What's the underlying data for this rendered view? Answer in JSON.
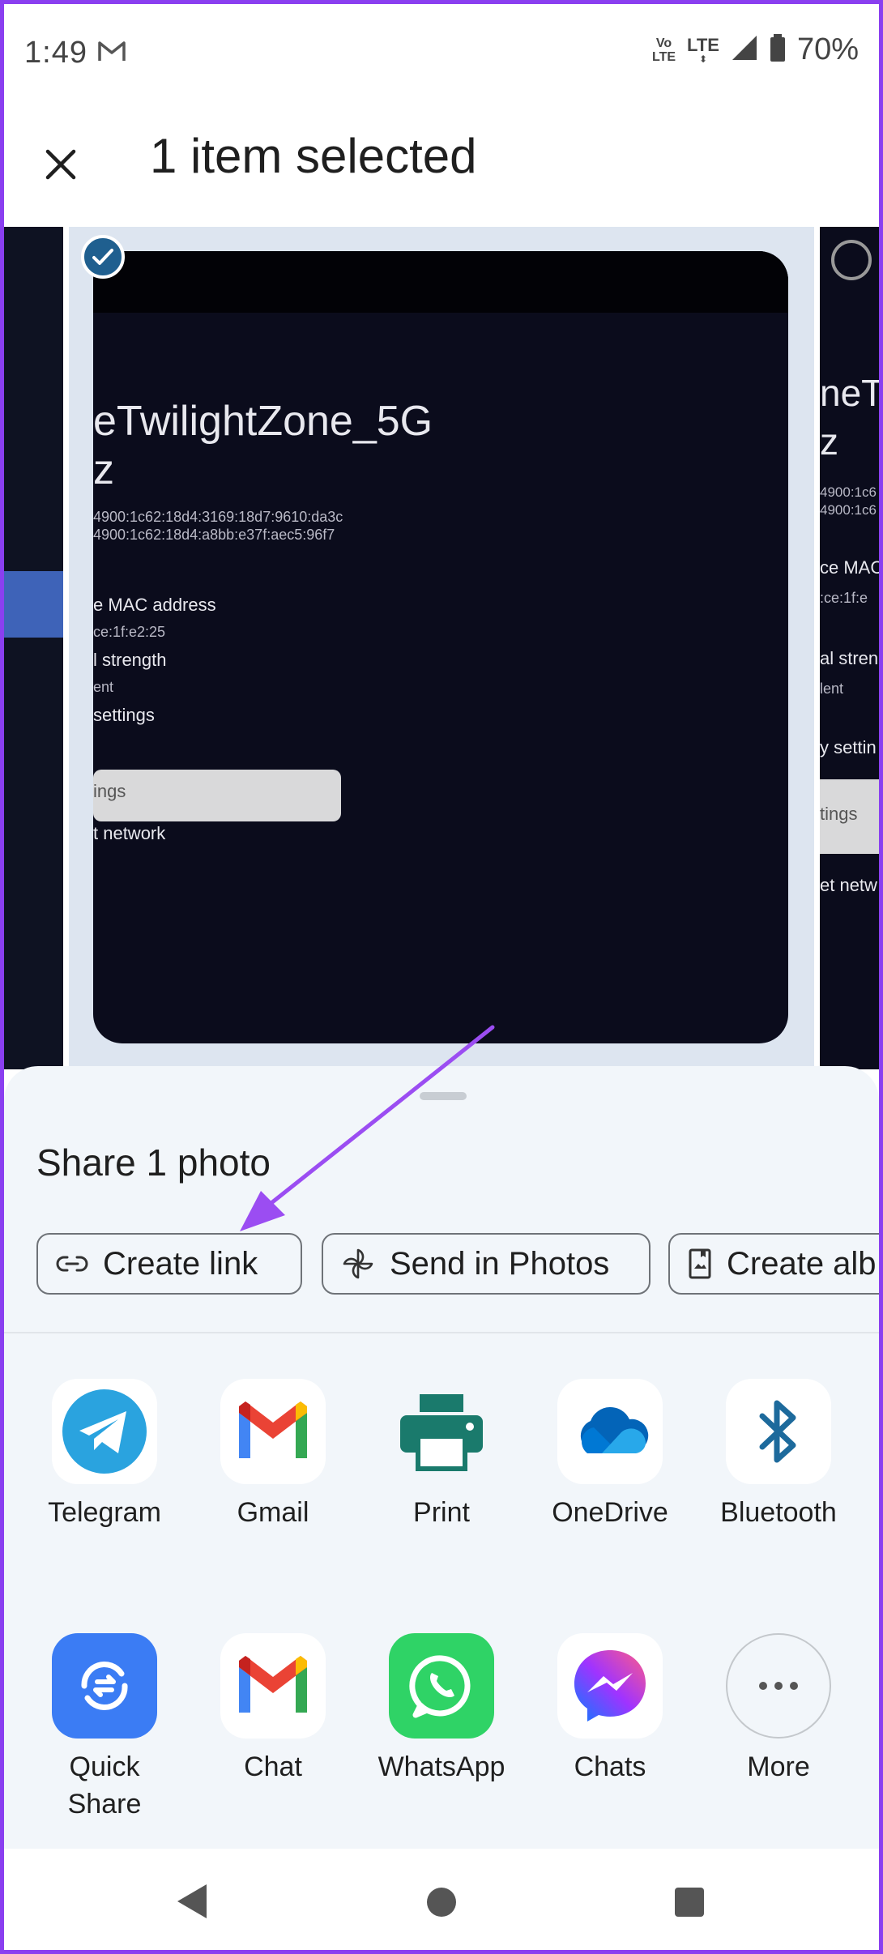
{
  "status_bar": {
    "time": "1:49",
    "network_volte_top": "Vo",
    "network_volte_bottom": "LTE",
    "network_lte": "LTE",
    "battery_percent": "70%"
  },
  "header": {
    "title": "1 item selected"
  },
  "photo": {
    "network_name": "eTwilightZone_5G",
    "partial_line": "z",
    "ipv6_line1": "4900:1c62:18d4:3169:18d7:9610:da3c",
    "ipv6_line2": "4900:1c62:18d4:a8bb:e37f:aec5:96f7",
    "mac_label": "e MAC address",
    "mac_value": "ce:1f:e2:25",
    "signal_label": "l strength",
    "signal_value": "ent",
    "settings_label": "settings",
    "button_label": "ings",
    "forget_label": "t network"
  },
  "photo_right": {
    "network_name": "neT",
    "partial_line": "z",
    "ipv6_line1": "4900:1c6",
    "ipv6_line2": "4900:1c6",
    "mac_label": "ce MAC",
    "mac_value": ":ce:1f:e",
    "signal_label": "al stren",
    "signal_value": "lent",
    "settings_label": "y settin",
    "button_label": "tings",
    "forget_label": "et netw"
  },
  "share": {
    "title": "Share 1 photo",
    "chips": [
      {
        "label": "Create link",
        "icon": "link-icon"
      },
      {
        "label": "Send in Photos",
        "icon": "pinwheel-icon"
      },
      {
        "label": "Create alb",
        "icon": "album-icon"
      }
    ],
    "apps_row1": [
      {
        "label": "Telegram",
        "icon": "telegram-icon"
      },
      {
        "label": "Gmail",
        "icon": "gmail-icon"
      },
      {
        "label": "Print",
        "icon": "print-icon"
      },
      {
        "label": "OneDrive",
        "icon": "onedrive-icon"
      },
      {
        "label": "Bluetooth",
        "icon": "bluetooth-icon"
      }
    ],
    "apps_row2": [
      {
        "label_line1": "Quick",
        "label_line2": "Share",
        "icon": "quick-share-icon"
      },
      {
        "label": "Chat",
        "icon": "chat-icon"
      },
      {
        "label": "WhatsApp",
        "icon": "whatsapp-icon"
      },
      {
        "label": "Chats",
        "icon": "messenger-icon"
      },
      {
        "label": "More",
        "icon": "more-icon"
      }
    ]
  },
  "colors": {
    "accent_arrow": "#9b4df2",
    "sheet_background": "#f2f6fa",
    "check_badge": "#1f5f8f"
  }
}
